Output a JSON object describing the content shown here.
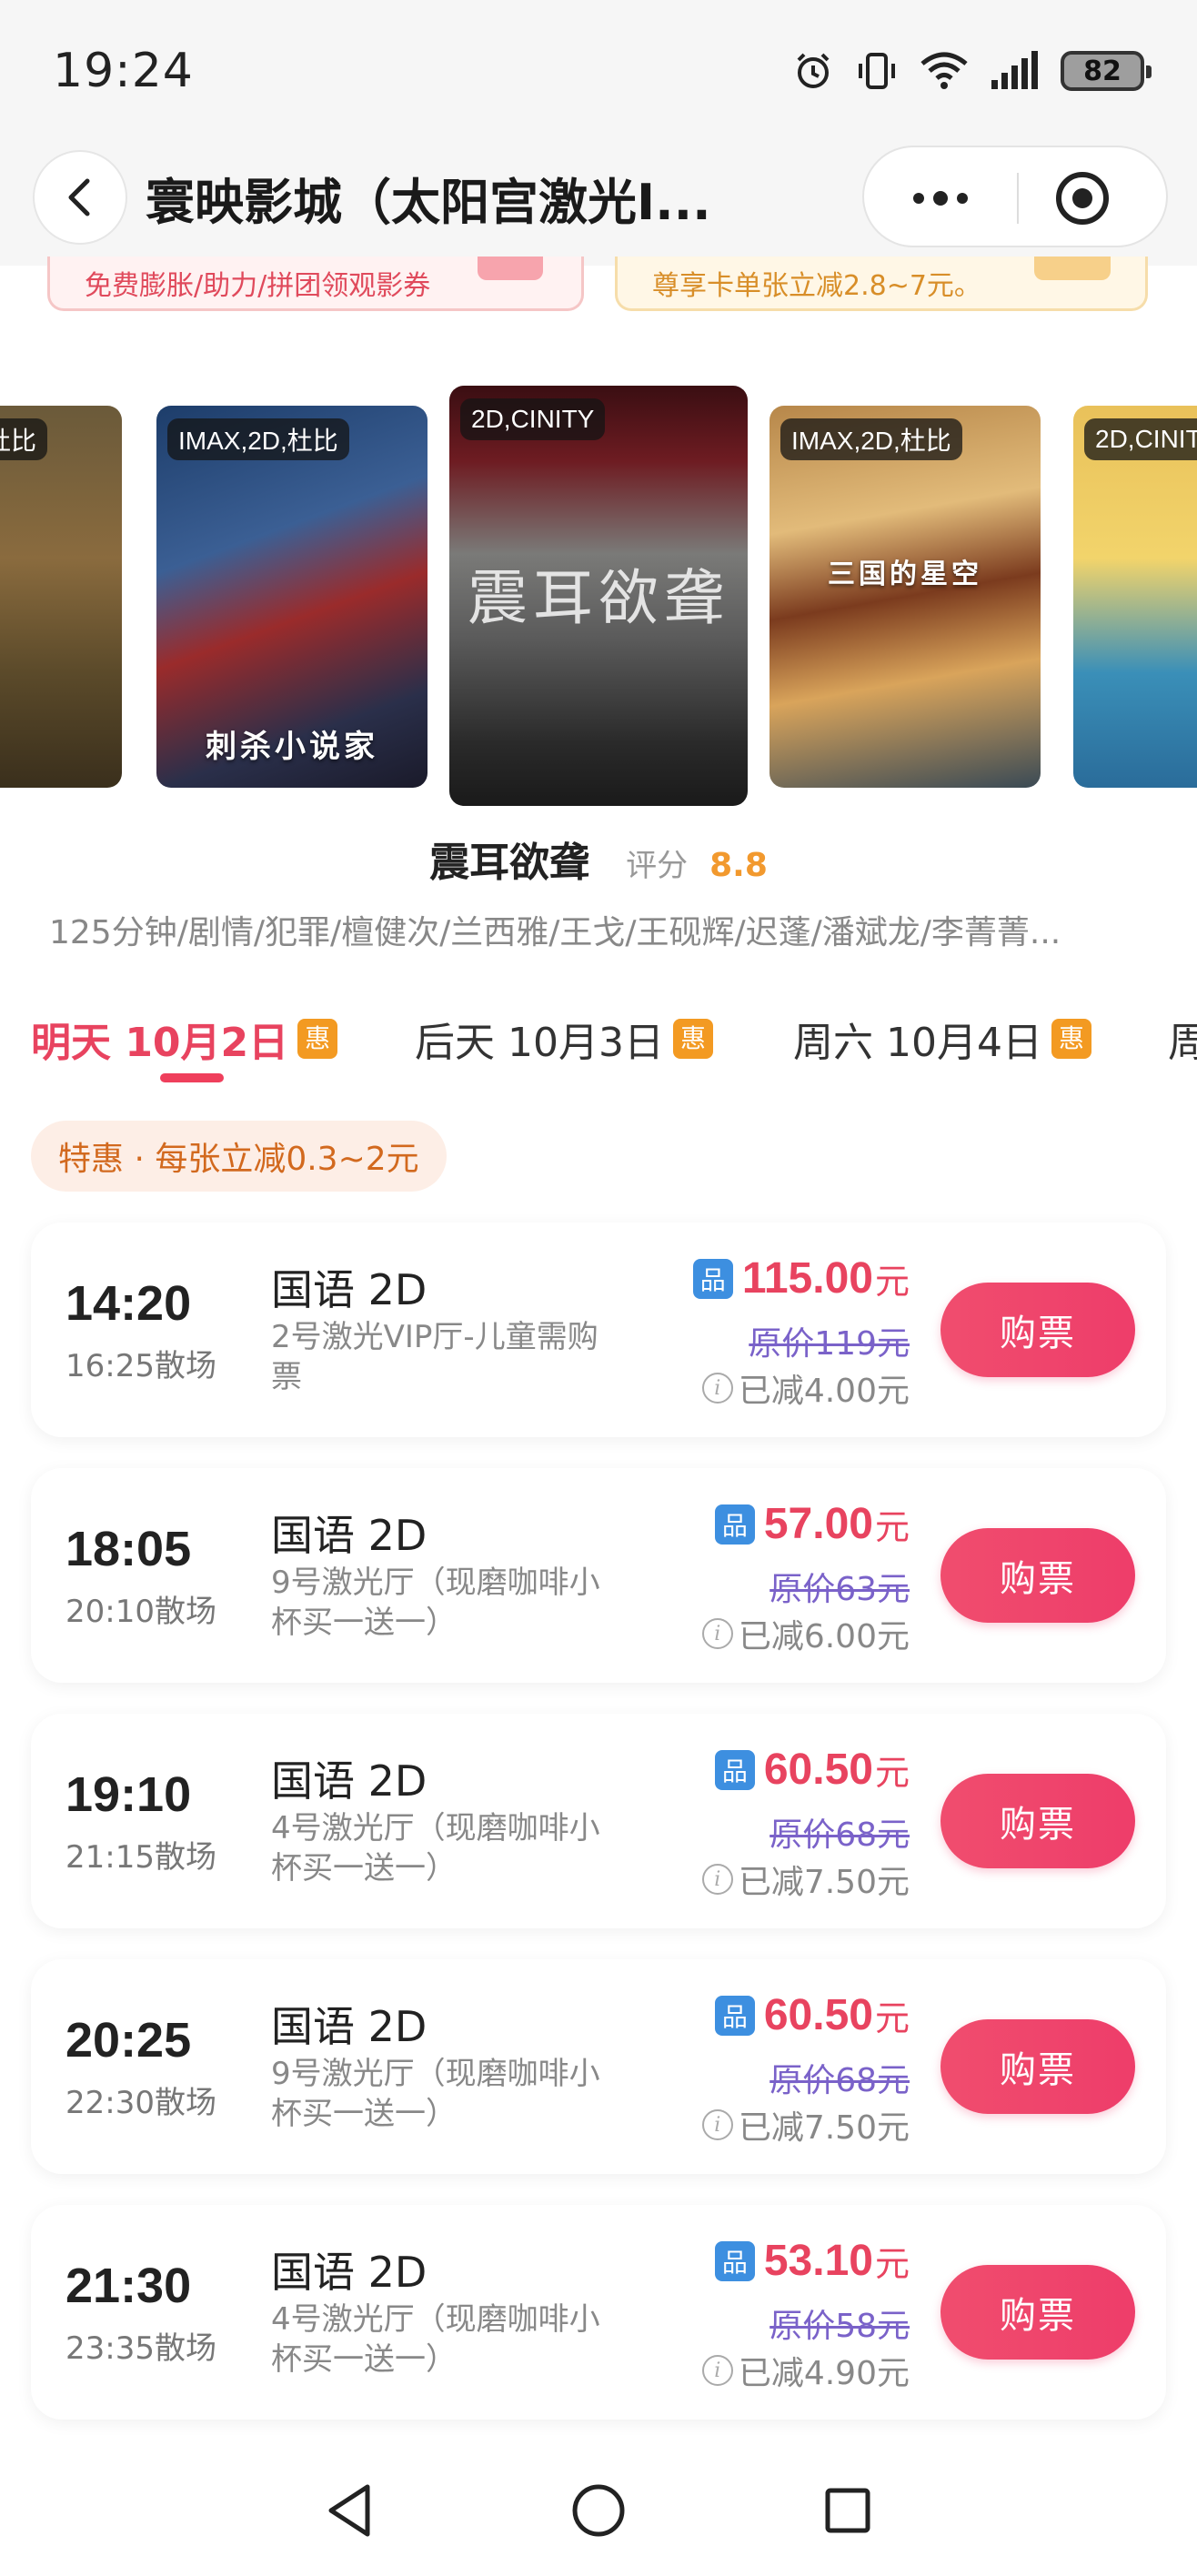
{
  "status_bar": {
    "time": "19:24",
    "battery": "82",
    "icons": [
      "alarm-icon",
      "vibrate-icon",
      "wifi-icon",
      "signal-icon",
      "battery-icon"
    ]
  },
  "nav": {
    "title": "寰映影城（太阳宫激光I...",
    "back_icon": "chevron-left-icon",
    "more_icon": "more-dots-icon",
    "close_icon": "target-circle-icon"
  },
  "promos": {
    "left": "免费膨胀/助力/拼团领观影券",
    "right": "尊享卡单张立减2.8~7元。"
  },
  "posters": [
    {
      "badge": "杜比",
      "caption": ""
    },
    {
      "badge": "IMAX,2D,杜比",
      "caption": "刺杀小说家"
    },
    {
      "badge": "2D,CINITY",
      "caption": "震耳欲聋"
    },
    {
      "badge": "IMAX,2D,杜比",
      "caption": "三国的星空"
    },
    {
      "badge": "2D,CINIT",
      "caption": ""
    }
  ],
  "movie": {
    "name": "震耳欲聋",
    "rating_label": "评分",
    "rating": "8.8",
    "meta": "125分钟/剧情/犯罪/檀健次/兰西雅/王戈/王砚辉/迟蓬/潘斌龙/李菁菁..."
  },
  "date_tabs": [
    {
      "label": "明天 10月2日",
      "badge": "惠",
      "active": true
    },
    {
      "label": "后天 10月3日",
      "badge": "惠",
      "active": false
    },
    {
      "label": "周六 10月4日",
      "badge": "惠",
      "active": false
    },
    {
      "label": "周",
      "badge": "",
      "active": false
    }
  ],
  "discount_chip": "特惠 · 每张立减0.3~2元",
  "sessions": [
    {
      "start": "14:20",
      "end": "16:25散场",
      "lang": "国语 2D",
      "hall": "2号激光VIP厅-儿童需购票",
      "tag": "品",
      "price": "115.00",
      "unit": "元",
      "orig": "原价119元",
      "saved": "已减4.00元",
      "buy": "购票"
    },
    {
      "start": "18:05",
      "end": "20:10散场",
      "lang": "国语 2D",
      "hall": "9号激光厅（现磨咖啡小杯买一送一）",
      "tag": "品",
      "price": "57.00",
      "unit": "元",
      "orig": "原价63元",
      "saved": "已减6.00元",
      "buy": "购票"
    },
    {
      "start": "19:10",
      "end": "21:15散场",
      "lang": "国语 2D",
      "hall": "4号激光厅（现磨咖啡小杯买一送一）",
      "tag": "品",
      "price": "60.50",
      "unit": "元",
      "orig": "原价68元",
      "saved": "已减7.50元",
      "buy": "购票"
    },
    {
      "start": "20:25",
      "end": "22:30散场",
      "lang": "国语 2D",
      "hall": "9号激光厅（现磨咖啡小杯买一送一）",
      "tag": "品",
      "price": "60.50",
      "unit": "元",
      "orig": "原价68元",
      "saved": "已减7.50元",
      "buy": "购票"
    },
    {
      "start": "21:30",
      "end": "23:35散场",
      "lang": "国语 2D",
      "hall": "4号激光厅（现磨咖啡小杯买一送一）",
      "tag": "品",
      "price": "53.10",
      "unit": "元",
      "orig": "原价58元",
      "saved": "已减4.90元",
      "buy": "购票"
    }
  ],
  "system_nav": {
    "back": "triangle-back-icon",
    "home": "circle-home-icon",
    "recents": "square-recents-icon"
  },
  "colors": {
    "accent": "#e8435f",
    "badge_orange": "#f39a22",
    "tag_blue": "#3d8fe0",
    "orig_purple": "#7a62c9",
    "rating": "#f2992e"
  }
}
